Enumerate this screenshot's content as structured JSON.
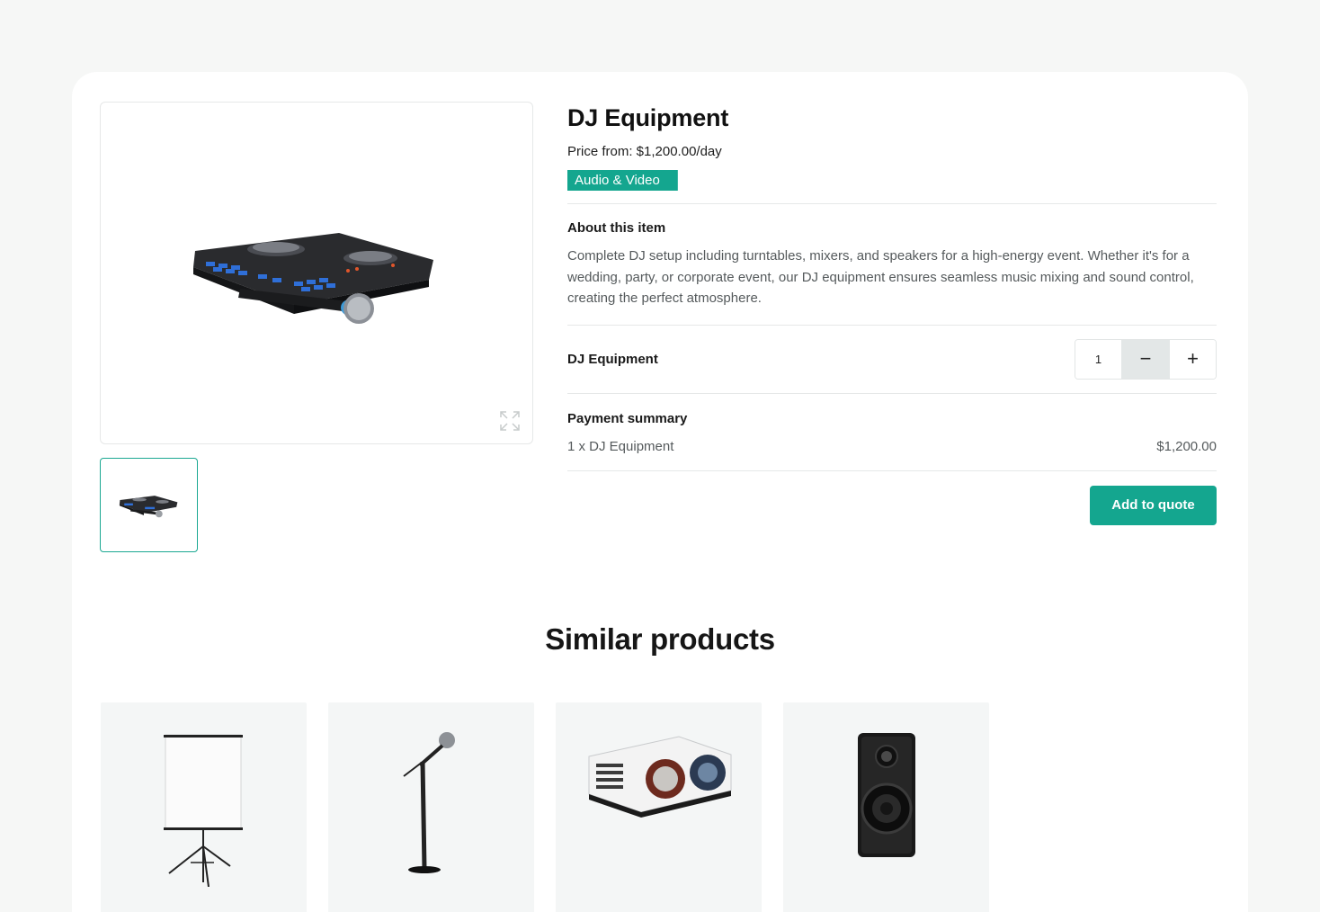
{
  "product": {
    "title": "DJ Equipment",
    "price": "Price from: $1,200.00/day",
    "category": "Audio & Video",
    "about_heading": "About this item",
    "about_text": "Complete DJ setup including turntables, mixers, and speakers for a high-energy event. Whether it's for a wedding, party, or corporate event, our DJ equipment ensures seamless music mixing and sound control, creating the perfect atmosphere."
  },
  "quantity": {
    "label": "DJ Equipment",
    "value": "1",
    "minus": "−",
    "plus": "+"
  },
  "payment": {
    "heading": "Payment summary",
    "line_label": "1 x DJ Equipment",
    "line_amount": "$1,200.00"
  },
  "actions": {
    "add_to_quote": "Add to quote"
  },
  "similar": {
    "title": "Similar products",
    "items": [
      "projector-screen-image",
      "microphone-stand-image",
      "projector-image",
      "speaker-image"
    ]
  },
  "colors": {
    "accent": "#14a68f",
    "background": "#f6f7f6"
  }
}
